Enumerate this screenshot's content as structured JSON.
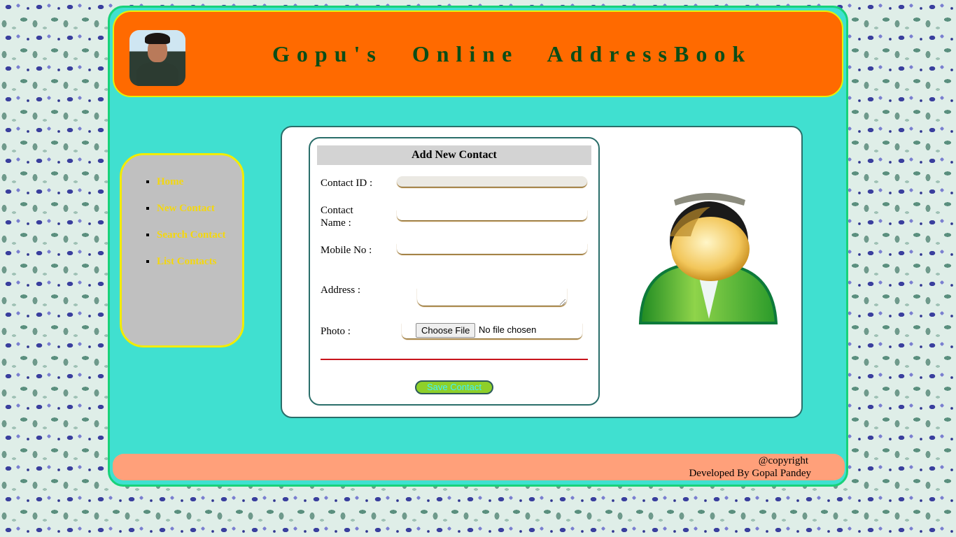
{
  "header": {
    "title": "Gopu's Online AddressBook"
  },
  "sidebar": {
    "items": [
      {
        "label": "Home"
      },
      {
        "label": "New Contact"
      },
      {
        "label": "Search Contact"
      },
      {
        "label": "List Contacts"
      }
    ]
  },
  "form": {
    "heading": "Add New Contact",
    "contact_id_label": "Contact ID :",
    "contact_id_value": "",
    "contact_name_label_1": "Contact",
    "contact_name_label_2": "Name :",
    "contact_name_value": "",
    "mobile_label": "Mobile No :",
    "mobile_value": "",
    "address_label": "Address :",
    "address_value": "",
    "photo_label": "Photo :",
    "file_button": "Choose File",
    "file_status": "No file chosen",
    "save_button": "Save Contact"
  },
  "footer": {
    "copyright": "@copyright",
    "developer": "Developed By Gopal Pandey"
  },
  "colors": {
    "header_bg": "#ff6a00",
    "frame_bg": "#40e0d0",
    "title_text": "#0b4d16",
    "nav_link": "#f4d70e",
    "sidebar_bg": "#c0c0c0",
    "footer_bg": "#ffa07a",
    "save_button_bg": "#8ed02a",
    "divider": "#c8141c"
  },
  "icons": {
    "profile_photo": "profile-avatar",
    "user_illustration": "user-silhouette-icon"
  }
}
